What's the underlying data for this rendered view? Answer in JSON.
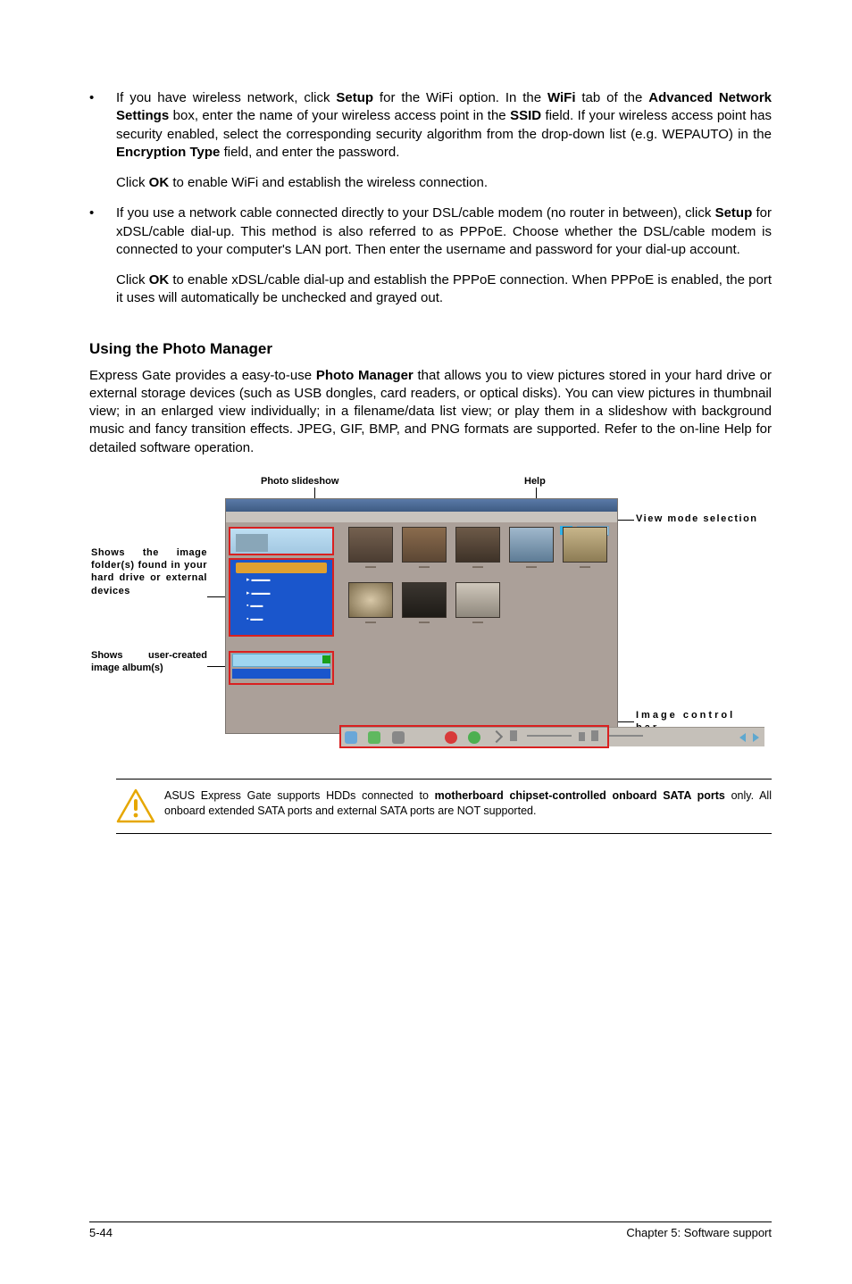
{
  "bullets": [
    {
      "main": "If you have wireless network, click <b>Setup</b> for the WiFi option. In the <b>WiFi</b> tab of the <b>Advanced Network Settings</b> box, enter the name of your wireless access point in the <b>SSID</b> field. If your wireless access point has security enabled, select the corresponding security algorithm from the drop-down list (e.g. WEPAUTO) in the <b>Encryption Type</b> field, and enter the password.",
      "sub": "Click <b>OK</b> to enable WiFi and establish the wireless connection."
    },
    {
      "main": "If you use a network cable connected directly to your DSL/cable modem (no router in between), click <b>Setup</b> for xDSL/cable dial-up. This method is also referred to as PPPoE. Choose whether the DSL/cable modem is connected to your computer's LAN port. Then enter the username and password for your dial-up account.",
      "sub": "Click <b>OK</b> to enable xDSL/cable dial-up and establish the PPPoE connection. When PPPoE is enabled, the port it uses will automatically be unchecked and grayed out."
    }
  ],
  "heading": "Using the Photo Manager",
  "body": "Express Gate  provides a easy-to-use <b>Photo Manager</b> that allows you to view pictures stored in your hard drive or external storage devices (such as USB dongles, card readers, or optical disks). You can view pictures in thumbnail view; in an enlarged view individually; in a filename/data list view; or play them in a slideshow with background music and fancy transition effects. JPEG, GIF, BMP, and PNG formats are supported. Refer to the on-line Help for detailed software operation.",
  "labels": {
    "slideshow": "Photo slideshow",
    "help": "Help",
    "viewmode": "View mode selection",
    "leftA": "Shows the image folder(s) found in your hard drive or external devices",
    "leftB": "Shows user-created image album(s)",
    "imgbar": "Image control bar"
  },
  "note": "ASUS Express Gate supports HDDs connected to <b>motherboard chipset-controlled onboard SATA ports</b> only. All onboard extended SATA ports and external SATA ports are NOT supported.",
  "footer": {
    "left": "5-44",
    "right": "Chapter 5: Software support"
  }
}
